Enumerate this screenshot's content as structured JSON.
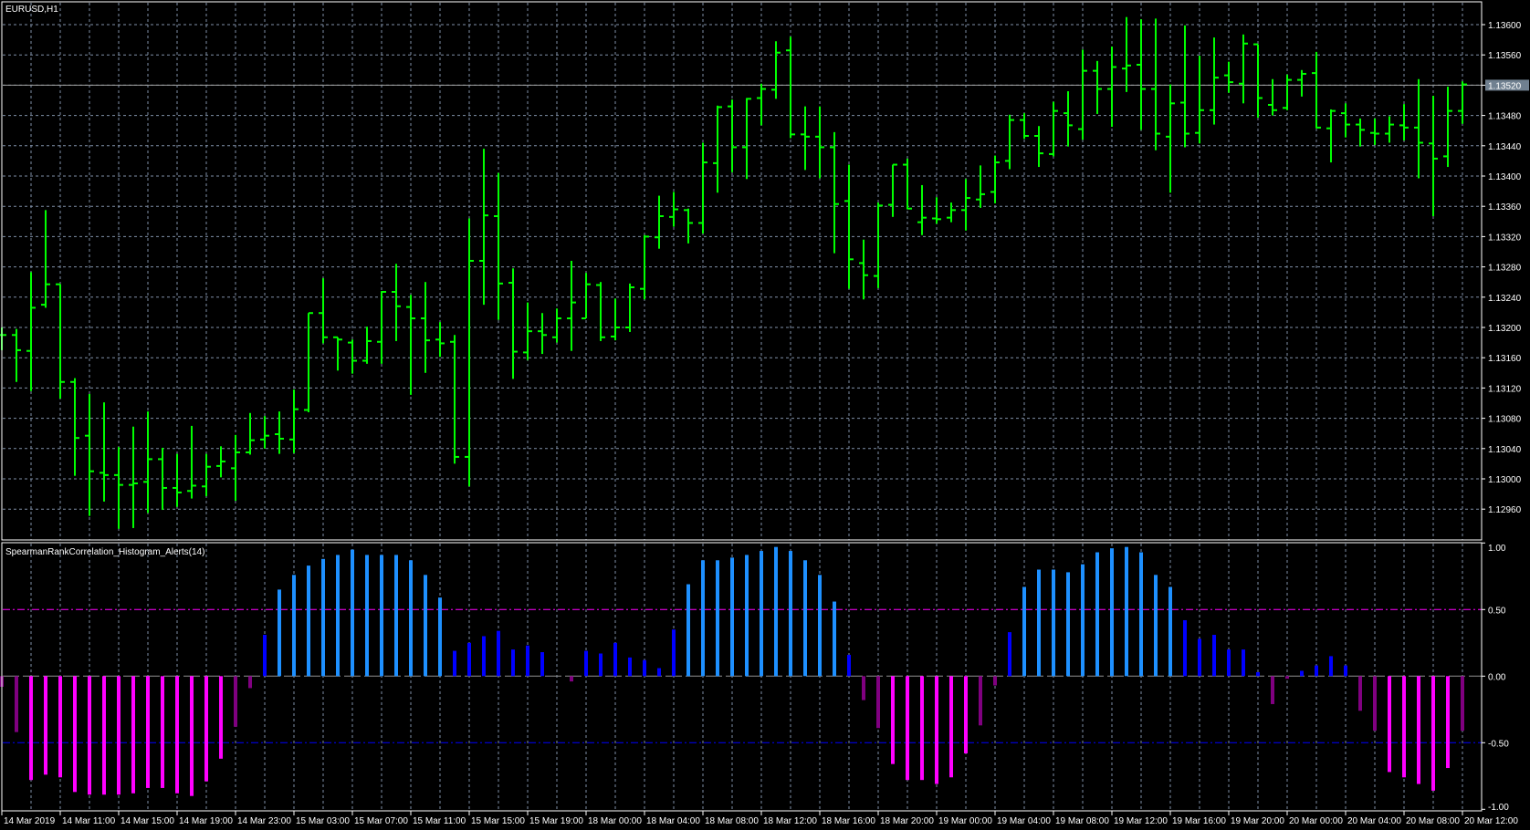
{
  "window": {
    "title": "EURUSD,H1"
  },
  "colors": {
    "background": "#000000",
    "bars": "#00FF00",
    "grid": "#8090A8",
    "frame": "#FFFFFF",
    "bid_line": "#A0A0A0",
    "bid_label_bg": "#708090",
    "strong_up": "#1E90FF",
    "weak_up": "#0000FF",
    "strong_down": "#FF00FF",
    "weak_down": "#800080",
    "upper_level": "#FF00FF",
    "lower_level": "#0000FF"
  },
  "chart_data": [
    {
      "type": "ohlc",
      "title": "EURUSD,H1",
      "symbol": "EURUSD",
      "timeframe": "H1",
      "ylim": [
        1.1292,
        1.1363
      ],
      "grid": true,
      "y_ticks": [
        "1.13600",
        "1.13560",
        "1.13520",
        "1.13480",
        "1.13440",
        "1.13400",
        "1.13360",
        "1.13320",
        "1.13280",
        "1.13240",
        "1.13200",
        "1.13160",
        "1.13120",
        "1.13080",
        "1.13040",
        "1.13000",
        "1.12960"
      ],
      "y_tick_values": [
        1.136,
        1.1356,
        1.1352,
        1.1348,
        1.1344,
        1.134,
        1.1336,
        1.1332,
        1.1328,
        1.1324,
        1.132,
        1.1316,
        1.1312,
        1.1308,
        1.1304,
        1.13,
        1.1296
      ],
      "bid": {
        "label": "1.13520",
        "value": 1.1352
      },
      "ohlc": [
        [
          1.1319,
          1.132,
          1.1317,
          1.1319
        ],
        [
          1.1319,
          1.13198,
          1.13128,
          1.1317
        ],
        [
          1.13169,
          1.13273,
          1.13116,
          1.13226
        ],
        [
          1.1323,
          1.13355,
          1.13226,
          1.13257
        ],
        [
          1.13257,
          1.13257,
          1.13106,
          1.13128
        ],
        [
          1.13128,
          1.13133,
          1.13004,
          1.13054
        ],
        [
          1.13057,
          1.13112,
          1.12951,
          1.1301
        ],
        [
          1.13008,
          1.13101,
          1.1297,
          1.13005
        ],
        [
          1.13005,
          1.13042,
          1.12934,
          1.12992
        ],
        [
          1.12992,
          1.13069,
          1.12935,
          1.12994
        ],
        [
          1.12996,
          1.13089,
          1.12955,
          1.13026
        ],
        [
          1.13026,
          1.13041,
          1.12959,
          1.12988
        ],
        [
          1.12988,
          1.13033,
          1.12963,
          1.12982
        ],
        [
          1.12984,
          1.1307,
          1.12974,
          1.12991
        ],
        [
          1.1299,
          1.13033,
          1.12977,
          1.13016
        ],
        [
          1.13017,
          1.13043,
          1.13002,
          1.13023
        ],
        [
          1.13014,
          1.13058,
          1.12971,
          1.13035
        ],
        [
          1.13035,
          1.13087,
          1.13032,
          1.13051
        ],
        [
          1.13052,
          1.13083,
          1.1304,
          1.13057
        ],
        [
          1.13059,
          1.13089,
          1.13033,
          1.13053
        ],
        [
          1.13052,
          1.13118,
          1.13034,
          1.13092
        ],
        [
          1.13091,
          1.13219,
          1.13088,
          1.13219
        ],
        [
          1.13219,
          1.13265,
          1.13179,
          1.13187
        ],
        [
          1.13187,
          1.13187,
          1.13143,
          1.13184
        ],
        [
          1.1318,
          1.13184,
          1.13139,
          1.13156
        ],
        [
          1.13156,
          1.13201,
          1.13152,
          1.13182
        ],
        [
          1.13181,
          1.13248,
          1.13152,
          1.13247
        ],
        [
          1.13247,
          1.13284,
          1.13182,
          1.13228
        ],
        [
          1.13227,
          1.13243,
          1.13111,
          1.13212
        ],
        [
          1.13212,
          1.1326,
          1.1314,
          1.13183
        ],
        [
          1.13184,
          1.13207,
          1.13161,
          1.13179
        ],
        [
          1.13181,
          1.1319,
          1.1302,
          1.13029
        ],
        [
          1.13029,
          1.13344,
          1.1299,
          1.13288
        ],
        [
          1.13288,
          1.13436,
          1.1323,
          1.13348
        ],
        [
          1.13347,
          1.13404,
          1.1321,
          1.13258
        ],
        [
          1.13259,
          1.13278,
          1.13132,
          1.13168
        ],
        [
          1.13167,
          1.13233,
          1.13157,
          1.13195
        ],
        [
          1.13195,
          1.13219,
          1.13165,
          1.1319
        ],
        [
          1.13187,
          1.13225,
          1.1318,
          1.13212
        ],
        [
          1.13212,
          1.13288,
          1.13169,
          1.13233
        ],
        [
          1.13212,
          1.13272,
          1.13212,
          1.13257
        ],
        [
          1.13256,
          1.1326,
          1.13182,
          1.13187
        ],
        [
          1.13188,
          1.13238,
          1.13183,
          1.132
        ],
        [
          1.132,
          1.13258,
          1.13194,
          1.13253
        ],
        [
          1.13251,
          1.13322,
          1.13237,
          1.1332
        ],
        [
          1.13319,
          1.13374,
          1.13304,
          1.13347
        ],
        [
          1.13346,
          1.13379,
          1.13333,
          1.13356
        ],
        [
          1.13355,
          1.13357,
          1.13311,
          1.13338
        ],
        [
          1.13338,
          1.13444,
          1.13324,
          1.13418
        ],
        [
          1.13417,
          1.13493,
          1.13378,
          1.13491
        ],
        [
          1.13492,
          1.13501,
          1.13405,
          1.13438
        ],
        [
          1.13438,
          1.13503,
          1.13396,
          1.13502
        ],
        [
          1.13503,
          1.13522,
          1.13467,
          1.13515
        ],
        [
          1.13514,
          1.13578,
          1.13502,
          1.13563
        ],
        [
          1.13566,
          1.13584,
          1.1345,
          1.13455
        ],
        [
          1.13455,
          1.13492,
          1.13408,
          1.13452
        ],
        [
          1.13452,
          1.13492,
          1.13397,
          1.13438
        ],
        [
          1.13438,
          1.13458,
          1.13298,
          1.13363
        ],
        [
          1.13367,
          1.13415,
          1.13251,
          1.1329
        ],
        [
          1.13285,
          1.13316,
          1.13237,
          1.13269
        ],
        [
          1.13268,
          1.13365,
          1.13252,
          1.13361
        ],
        [
          1.13362,
          1.13415,
          1.13346,
          1.13415
        ],
        [
          1.13415,
          1.13423,
          1.13356,
          1.13357
        ],
        [
          1.13339,
          1.13388,
          1.13322,
          1.13345
        ],
        [
          1.13344,
          1.13372,
          1.13337,
          1.13343
        ],
        [
          1.13345,
          1.13365,
          1.13339,
          1.13355
        ],
        [
          1.13355,
          1.13396,
          1.13328,
          1.13371
        ],
        [
          1.13369,
          1.13414,
          1.13358,
          1.13376
        ],
        [
          1.13379,
          1.13427,
          1.13364,
          1.13418
        ],
        [
          1.1342,
          1.13481,
          1.13409,
          1.13474
        ],
        [
          1.13474,
          1.13483,
          1.13449,
          1.13453
        ],
        [
          1.13453,
          1.13466,
          1.13412,
          1.1343
        ],
        [
          1.13429,
          1.13498,
          1.13426,
          1.13486
        ],
        [
          1.13483,
          1.13512,
          1.13439,
          1.13467
        ],
        [
          1.13462,
          1.13567,
          1.13448,
          1.13539
        ],
        [
          1.13539,
          1.13552,
          1.13482,
          1.13515
        ],
        [
          1.13515,
          1.13571,
          1.13465,
          1.13544
        ],
        [
          1.13542,
          1.1361,
          1.13511,
          1.13546
        ],
        [
          1.13547,
          1.13607,
          1.13461,
          1.13515
        ],
        [
          1.13515,
          1.13608,
          1.13434,
          1.13456
        ],
        [
          1.13452,
          1.13521,
          1.13378,
          1.13496
        ],
        [
          1.13497,
          1.13599,
          1.13438,
          1.13456
        ],
        [
          1.13457,
          1.13559,
          1.13443,
          1.13487
        ],
        [
          1.13487,
          1.13583,
          1.13468,
          1.1353
        ],
        [
          1.13533,
          1.13551,
          1.1351,
          1.13524
        ],
        [
          1.13522,
          1.13587,
          1.13496,
          1.13575
        ],
        [
          1.13574,
          1.13574,
          1.13477,
          1.13503
        ],
        [
          1.13494,
          1.13528,
          1.1348,
          1.13487
        ],
        [
          1.1349,
          1.13534,
          1.13487,
          1.13527
        ],
        [
          1.13527,
          1.1354,
          1.13505,
          1.13535
        ],
        [
          1.13536,
          1.13564,
          1.13463,
          1.13464
        ],
        [
          1.13463,
          1.13488,
          1.13418,
          1.13486
        ],
        [
          1.13483,
          1.13496,
          1.13451,
          1.13468
        ],
        [
          1.13468,
          1.13476,
          1.13439,
          1.13461
        ],
        [
          1.13457,
          1.13476,
          1.13441,
          1.13456
        ],
        [
          1.13456,
          1.13479,
          1.13444,
          1.13468
        ],
        [
          1.13467,
          1.13495,
          1.13447,
          1.13464
        ],
        [
          1.13464,
          1.13528,
          1.13397,
          1.13444
        ],
        [
          1.13443,
          1.13506,
          1.13347,
          1.13423
        ],
        [
          1.13426,
          1.13518,
          1.13412,
          1.13486
        ],
        [
          1.13486,
          1.13525,
          1.13469,
          1.13521
        ]
      ]
    },
    {
      "type": "bar",
      "title": "SpearmanRankCorrelation_Histogram_Alerts(14)",
      "ylim": [
        -1,
        1
      ],
      "y_ticks": [
        "1.00",
        "0.50",
        "0.00",
        "-0.50",
        "-1.00"
      ],
      "y_tick_values": [
        1,
        0.5,
        0,
        -0.5,
        -1
      ],
      "levels": [
        0.5,
        -0.5
      ],
      "values": [
        -0.08,
        -0.42,
        -0.78,
        -0.74,
        -0.76,
        -0.87,
        -0.89,
        -0.89,
        -0.89,
        -0.88,
        -0.84,
        -0.84,
        -0.88,
        -0.9,
        -0.79,
        -0.62,
        -0.38,
        -0.09,
        0.31,
        0.65,
        0.76,
        0.83,
        0.88,
        0.91,
        0.95,
        0.91,
        0.91,
        0.91,
        0.87,
        0.76,
        0.59,
        0.19,
        0.25,
        0.3,
        0.34,
        0.2,
        0.23,
        0.18,
        0,
        -0.04,
        0.19,
        0.17,
        0.25,
        0.14,
        0.12,
        0.06,
        0.35,
        0.69,
        0.87,
        0.87,
        0.89,
        0.91,
        0.94,
        0.97,
        0.94,
        0.87,
        0.76,
        0.56,
        0.16,
        -0.18,
        -0.39,
        -0.66,
        -0.78,
        -0.78,
        -0.81,
        -0.76,
        -0.58,
        -0.37,
        -0.07,
        0.33,
        0.67,
        0.8,
        0.8,
        0.78,
        0.84,
        0.93,
        0.96,
        0.97,
        0.93,
        0.76,
        0.67,
        0.42,
        0.28,
        0.31,
        0.2,
        0.2,
        0.03,
        -0.21,
        -0.02,
        0.04,
        0.08,
        0.15,
        0.08,
        -0.26,
        -0.41,
        -0.72,
        -0.76,
        -0.81,
        -0.86,
        -0.69,
        -0.41
      ]
    }
  ],
  "x_labels": [
    "14 Mar 2019",
    "14 Mar 11:00",
    "14 Mar 15:00",
    "14 Mar 19:00",
    "14 Mar 23:00",
    "15 Mar 03:00",
    "15 Mar 07:00",
    "15 Mar 11:00",
    "15 Mar 15:00",
    "15 Mar 19:00",
    "18 Mar 00:00",
    "18 Mar 04:00",
    "18 Mar 08:00",
    "18 Mar 12:00",
    "18 Mar 16:00",
    "18 Mar 20:00",
    "19 Mar 00:00",
    "19 Mar 04:00",
    "19 Mar 08:00",
    "19 Mar 12:00",
    "19 Mar 16:00",
    "19 Mar 20:00",
    "20 Mar 00:00",
    "20 Mar 04:00",
    "20 Mar 08:00",
    "20 Mar 12:00"
  ],
  "x_label_every_bars": 4
}
